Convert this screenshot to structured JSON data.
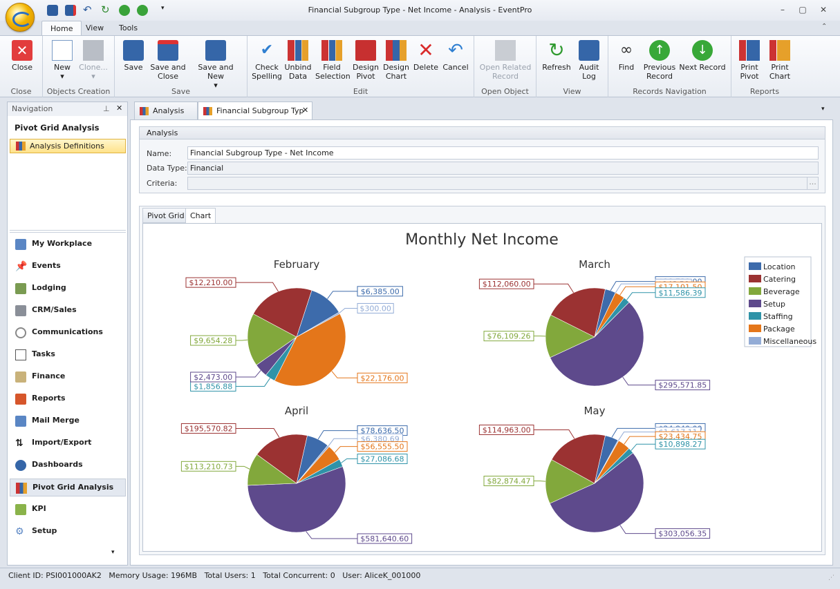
{
  "window": {
    "title": "Financial Subgroup Type - Net Income - Analysis - EventPro",
    "buttons": [
      "–",
      "▢",
      "✕"
    ]
  },
  "ribbon_tabs": [
    "Home",
    "View",
    "Tools"
  ],
  "ribbon": {
    "close": {
      "label": "Close",
      "group": "Close"
    },
    "objects": {
      "new": "New",
      "clone": "Clone...",
      "group": "Objects Creation"
    },
    "save": {
      "save": "Save",
      "save_close": "Save and\nClose",
      "save_new": "Save and New",
      "group": "Save"
    },
    "edit": {
      "check": "Check\nSpelling",
      "unbind": "Unbind\nData",
      "field": "Field\nSelection",
      "dpivot": "Design\nPivot",
      "dchart": "Design\nChart",
      "delete": "Delete",
      "cancel": "Cancel",
      "group": "Edit"
    },
    "open": {
      "related": "Open Related\nRecord",
      "group": "Open Object"
    },
    "view": {
      "refresh": "Refresh",
      "audit": "Audit\nLog",
      "group": "View"
    },
    "records": {
      "find": "Find",
      "prev": "Previous\nRecord",
      "next": "Next Record",
      "group": "Records Navigation"
    },
    "reports": {
      "ppivot": "Print\nPivot",
      "pchart": "Print\nChart",
      "group": "Reports"
    }
  },
  "nav": {
    "title": "Navigation",
    "subtitle": "Pivot Grid Analysis",
    "selected": "Analysis Definitions",
    "items": [
      "My Workplace",
      "Events",
      "Lodging",
      "CRM/Sales",
      "Communications",
      "Tasks",
      "Finance",
      "Reports",
      "Mail Merge",
      "Import/Export",
      "Dashboards",
      "Pivot Grid Analysis",
      "KPI",
      "Setup"
    ]
  },
  "doc_tabs": [
    "Analysis",
    "Financial Subgroup Typ"
  ],
  "form": {
    "section": "Analysis",
    "name_label": "Name:",
    "name_value": "Financial Subgroup Type - Net Income",
    "type_label": "Data Type:",
    "type_value": "Financial",
    "criteria_label": "Criteria:",
    "criteria_value": "",
    "ellipsis": "..."
  },
  "sub_tabs": [
    "Pivot Grid",
    "Chart"
  ],
  "chart_data": {
    "type": "pie",
    "title": "Monthly Net Income",
    "categories": [
      "Location",
      "Catering",
      "Beverage",
      "Setup",
      "Staffing",
      "Package",
      "Miscellaneous"
    ],
    "colors": [
      "#3d6bab",
      "#9b3232",
      "#82a83c",
      "#5e4a8c",
      "#2f93a8",
      "#e4761a",
      "#93acd6"
    ],
    "legend_position": "top-right",
    "pies": [
      {
        "name": "February",
        "values": [
          6385,
          12210,
          9654.28,
          2473,
          1856.88,
          22176,
          300
        ],
        "labels": [
          "$6,385.00",
          "$12,210.00",
          "$9,654.28",
          "$2,473.00",
          "$1,856.88",
          "$22,176.00",
          "$300.00"
        ]
      },
      {
        "name": "March",
        "values": [
          18739,
          112060,
          76109.26,
          295571.85,
          11586.39,
          17101.5,
          148.5
        ],
        "labels": [
          "$18,739.00",
          "$112,060.00",
          "$76,109.26",
          "$295,571.85",
          "$11,586.39",
          "$17,101.50",
          "$148.50"
        ]
      },
      {
        "name": "April",
        "values": [
          78636.5,
          195570.82,
          113210.73,
          581640.6,
          27086.68,
          56555.5,
          6380.69
        ],
        "labels": [
          "$78,636.50",
          "$195,570.82",
          "$113,210.73",
          "$581,640.60",
          "$27,086.68",
          "$56,555.50",
          "$6,380.69"
        ]
      },
      {
        "name": "May",
        "values": [
          24840,
          114963,
          82874.47,
          303056.35,
          10898.27,
          23434.75,
          1617.11
        ],
        "labels": [
          "$24,840.00",
          "$114,963.00",
          "$82,874.47",
          "$303,056.35",
          "$10,898.27",
          "$23,434.75",
          "$1,617.11"
        ]
      }
    ]
  },
  "status": "Client ID: PSI001000AK2   Memory Usage: 196MB   Total Users: 1   Total Concurrent: 0   User: AliceK_001000"
}
